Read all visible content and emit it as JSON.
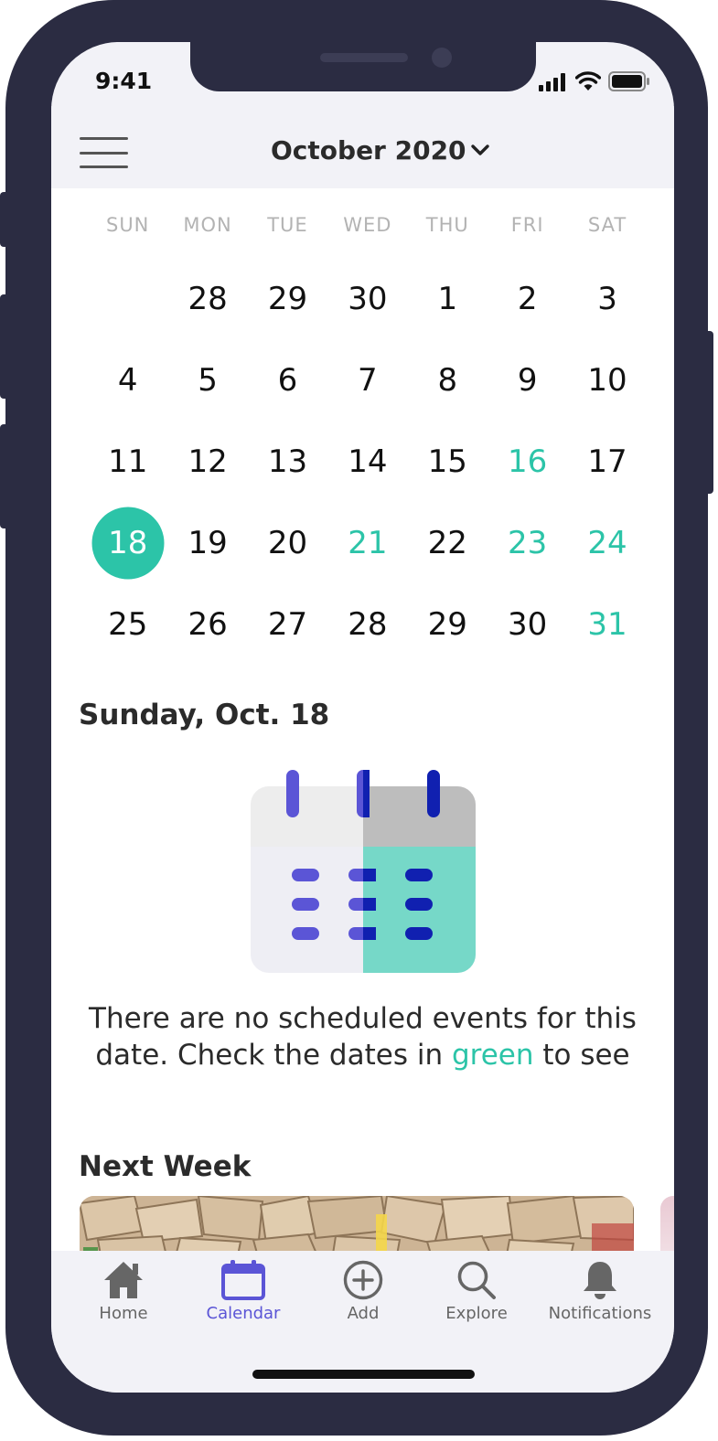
{
  "status_bar": {
    "time": "9:41"
  },
  "header": {
    "month_label": "October 2020"
  },
  "calendar": {
    "weekdays": [
      "SUN",
      "MON",
      "TUE",
      "WED",
      "THU",
      "FRI",
      "SAT"
    ],
    "weeks": [
      [
        null,
        28,
        29,
        30,
        1,
        2,
        3
      ],
      [
        4,
        5,
        6,
        7,
        8,
        9,
        10
      ],
      [
        11,
        12,
        13,
        14,
        15,
        16,
        17
      ],
      [
        18,
        19,
        20,
        21,
        22,
        23,
        24
      ],
      [
        25,
        26,
        27,
        28,
        29,
        30,
        31
      ]
    ],
    "event_dates": [
      16,
      21,
      23,
      24,
      31
    ],
    "selected_day": 18,
    "accent_color": "#2cc4a8"
  },
  "selected_date": {
    "title": "Sunday, Oct. 18"
  },
  "empty_state": {
    "line1": "There are no scheduled events for this",
    "line2_before": "date. Check the dates in ",
    "line2_highlight": "green",
    "line2_after": " to see"
  },
  "next_week": {
    "title": "Next Week"
  },
  "tab_bar": {
    "tabs": [
      {
        "label": "Home",
        "icon": "house-icon",
        "active": false
      },
      {
        "label": "Calendar",
        "icon": "calendar-icon",
        "active": true
      },
      {
        "label": "Add",
        "icon": "plus-circle-icon",
        "active": false
      },
      {
        "label": "Explore",
        "icon": "search-icon",
        "active": false
      },
      {
        "label": "Notifications",
        "icon": "bell-icon",
        "active": false
      }
    ],
    "active_color": "#5b55d6"
  }
}
